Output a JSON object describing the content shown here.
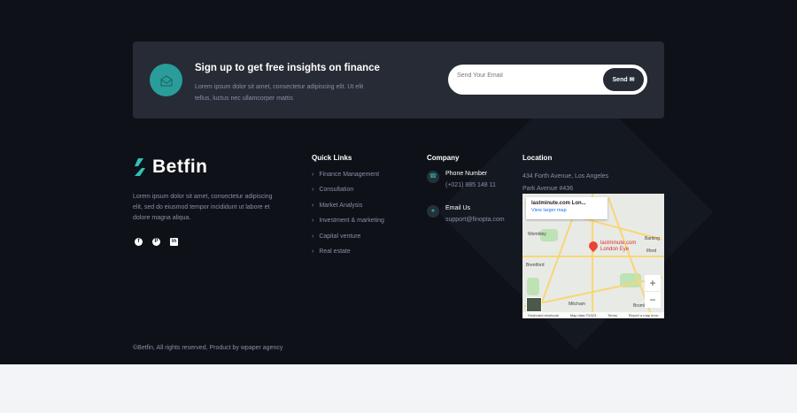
{
  "newsletter": {
    "title": "Sign up to get free insights on finance",
    "text": "Lorem ipsum dolor sit amet, consectetur adipiscing elit. Ut elit tellus, luctus nec ullamcorper mattis",
    "placeholder": "Send Your Email",
    "send_label": "Send"
  },
  "brand": {
    "name": "Betfin",
    "about": "Lorem ipsum dolor sit amet, consectetur adipiscing elit, sed do eiusmod tempor incididunt ut labore et dolore magna aliqua.",
    "social": [
      "f",
      "P",
      "in"
    ]
  },
  "quick_links": {
    "title": "Quick Links",
    "items": [
      "Finance Management",
      "Consultation",
      "Market Analysis",
      "Investment & marketing",
      "Capital venture",
      "Real estate"
    ]
  },
  "company": {
    "title": "Company",
    "phone_label": "Phone Number",
    "phone": "(+021) 885 148 11",
    "email_label": "Email Us",
    "email": "support@finopta.com"
  },
  "location": {
    "title": "Location",
    "line1": "434 Forth Avenue, Los Angeles",
    "line2": "Park Avenue #436"
  },
  "map": {
    "place": "lastminute.com Lon...",
    "view_larger": "View larger map",
    "pin_label1": "lastminute.com",
    "pin_label2": "London Eye",
    "zoom_in": "+",
    "zoom_out": "−",
    "footer": [
      "Keyboard shortcuts",
      "Map data ©2023",
      "Terms",
      "Report a map error"
    ],
    "labels": [
      "Wembley",
      "Brentford",
      "Barking",
      "Ilford",
      "Bromley",
      "Mitcham"
    ]
  },
  "copyright": "©Betfin, All rights reserved, Product by wpaper agency",
  "colors": {
    "accent": "#2a9d9a",
    "bg": "#0e1118",
    "band": "#262b35"
  }
}
